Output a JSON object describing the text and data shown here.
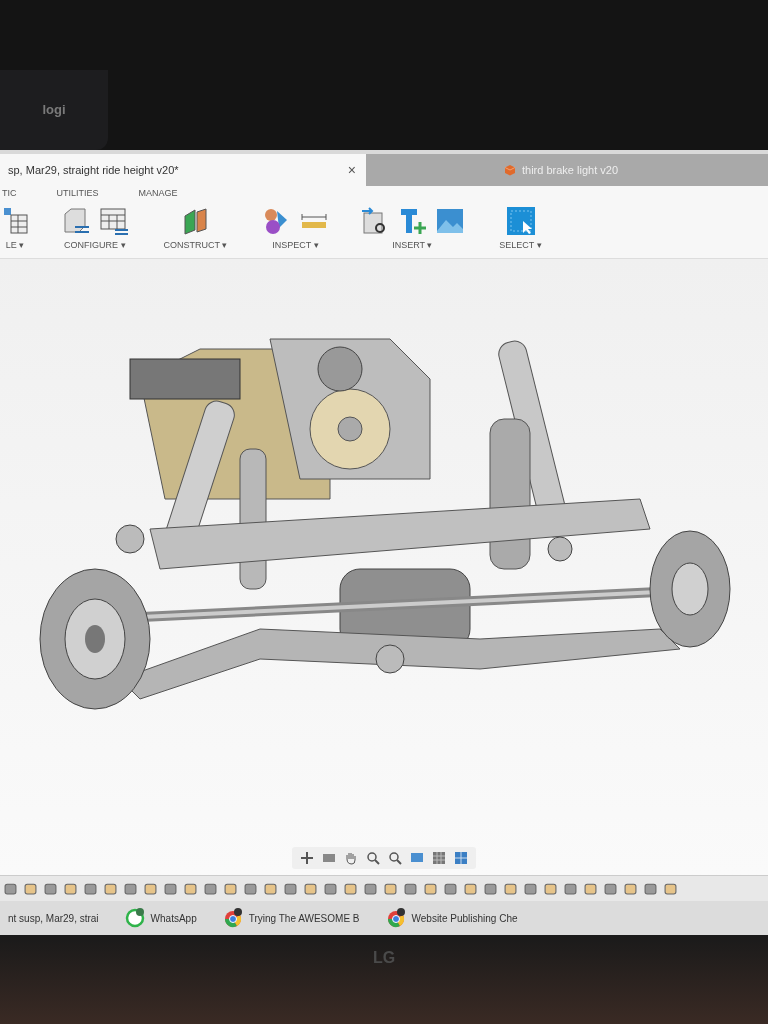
{
  "webcam": {
    "logo": "logi"
  },
  "document_tabs": [
    {
      "title": "sp, Mar29, straight ride height v20*",
      "close": "×",
      "selected": true
    },
    {
      "title": "third brake light v20",
      "selected": false
    }
  ],
  "toolbar_tabs": [
    "TIC",
    "UTILITIES",
    "MANAGE"
  ],
  "toolbar_groups": [
    {
      "kind": "table",
      "label": "LE ▾"
    },
    {
      "kind": "configure",
      "label": "CONFIGURE ▾"
    },
    {
      "kind": "construct",
      "label": "CONSTRUCT ▾"
    },
    {
      "kind": "inspect",
      "label": "INSPECT ▾"
    },
    {
      "kind": "insert",
      "label": "INSERT ▾"
    },
    {
      "kind": "select",
      "label": "SELECT ▾"
    }
  ],
  "taskbar": [
    {
      "kind": "document",
      "label": "nt susp, Mar29, strai"
    },
    {
      "kind": "whatsapp",
      "label": "WhatsApp"
    },
    {
      "kind": "chrome",
      "label": "Trying The AWESOME B"
    },
    {
      "kind": "chrome",
      "label": "Website Publishing Che"
    }
  ],
  "monitor": {
    "brand": "LG"
  }
}
